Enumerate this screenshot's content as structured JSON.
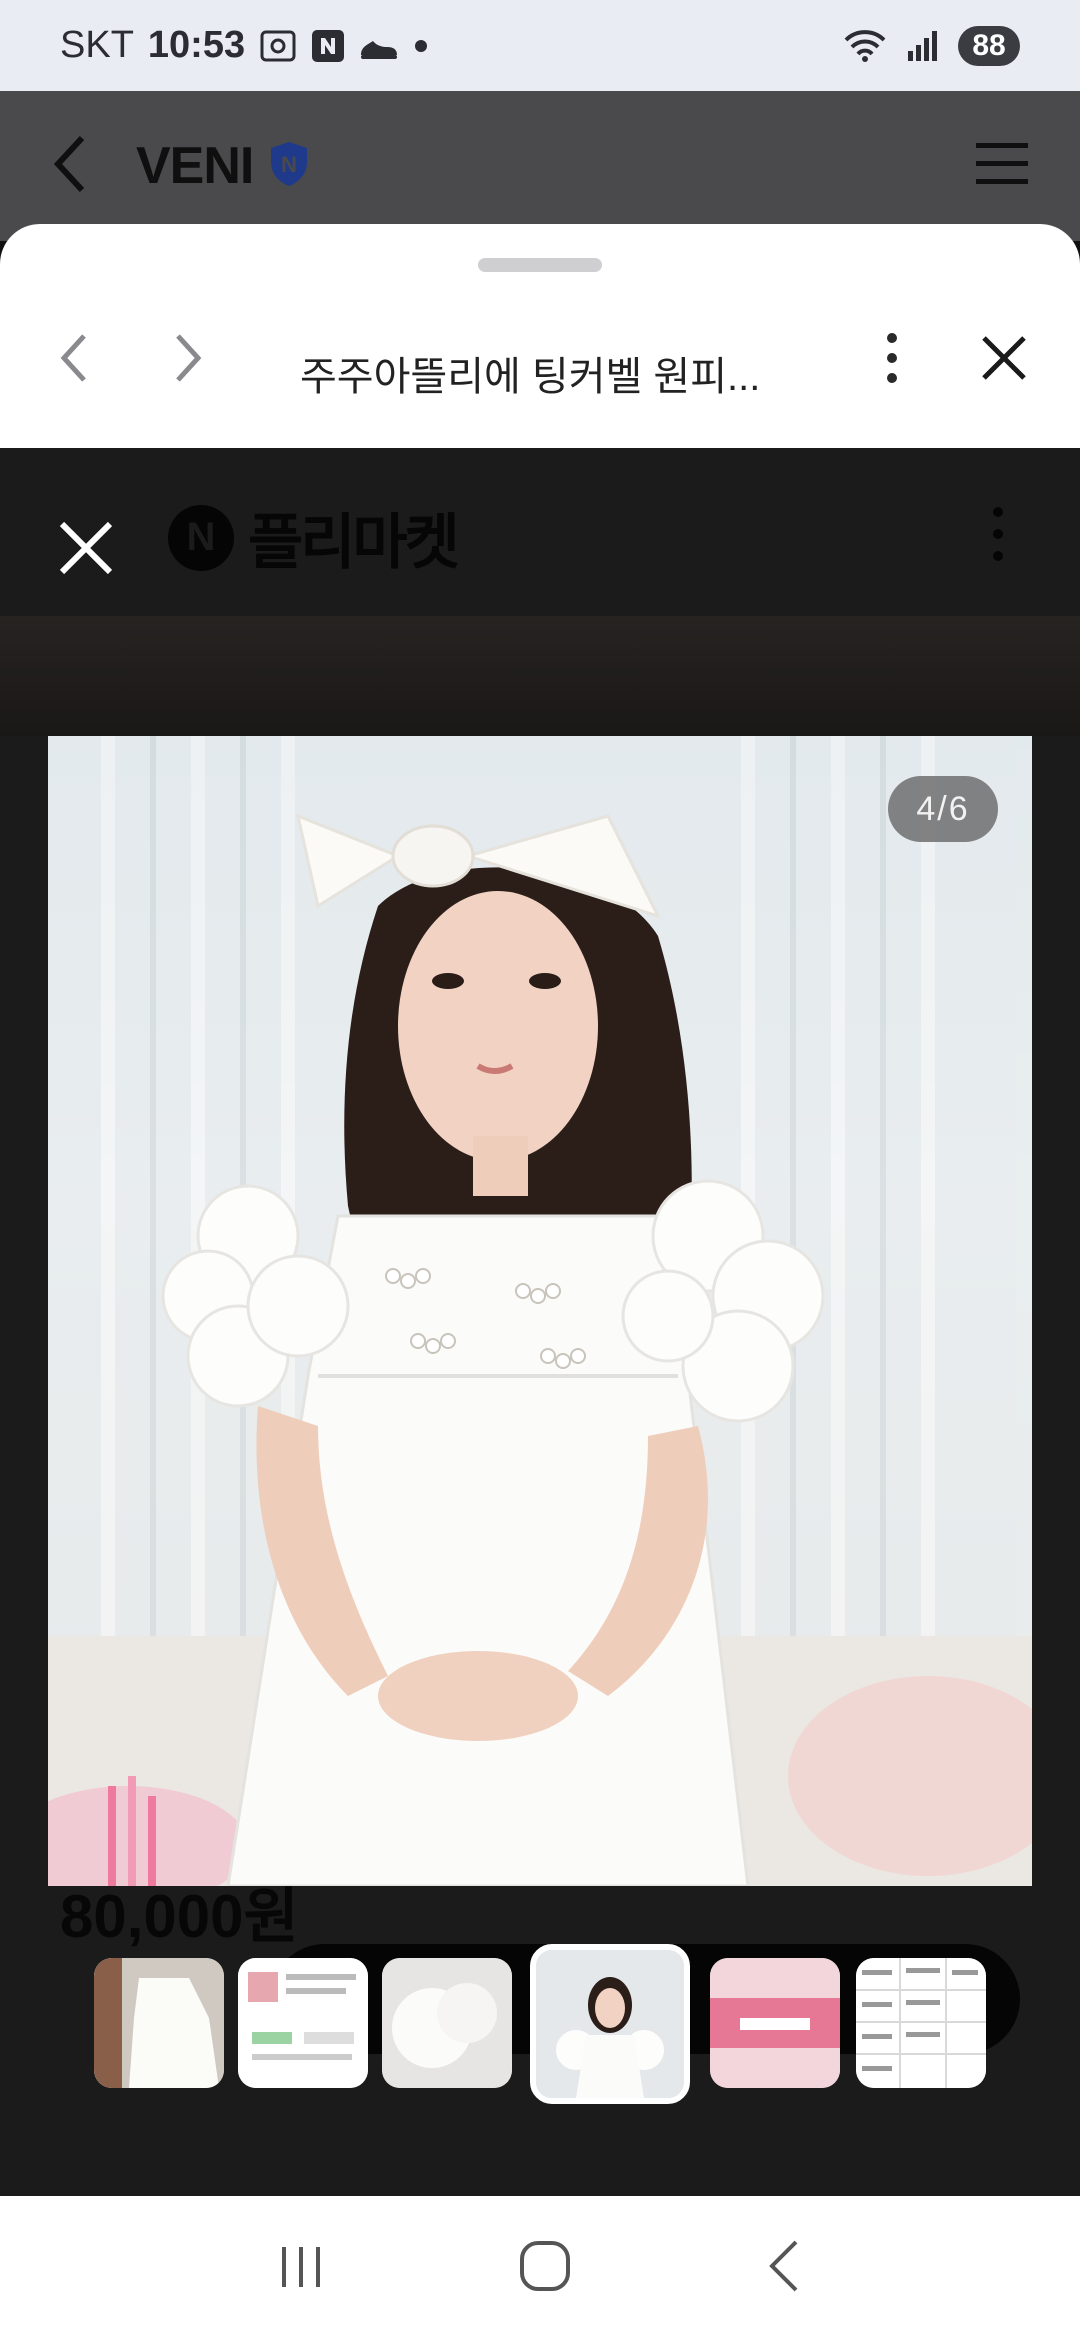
{
  "status_bar": {
    "carrier": "SKT",
    "time": "10:53",
    "battery": "88",
    "icons": [
      "screenshot-icon",
      "naver-n-icon",
      "sneaker-icon",
      "dot-icon",
      "wifi-icon",
      "signal-icon"
    ]
  },
  "app_header": {
    "title": "VENI",
    "badge_letter": "N"
  },
  "sheet": {
    "page_title": "주주아뜰리에 팅커벨 원피...",
    "web": {
      "brand_letter": "N",
      "brand_name": "플리마켓",
      "image_counter": "4/6",
      "price": "80,000원"
    },
    "thumbnails": [
      "dress-on-hanger",
      "order-screenshot",
      "dress-closeup",
      "girl-in-dress",
      "pink-banner",
      "size-table"
    ],
    "active_thumbnail_index": 3
  },
  "colors": {
    "status_bg": "#e9ecf3",
    "header_bg": "#4a4a4c",
    "web_bg": "#1b1b1b",
    "shield_blue": "#1f3a8a"
  }
}
